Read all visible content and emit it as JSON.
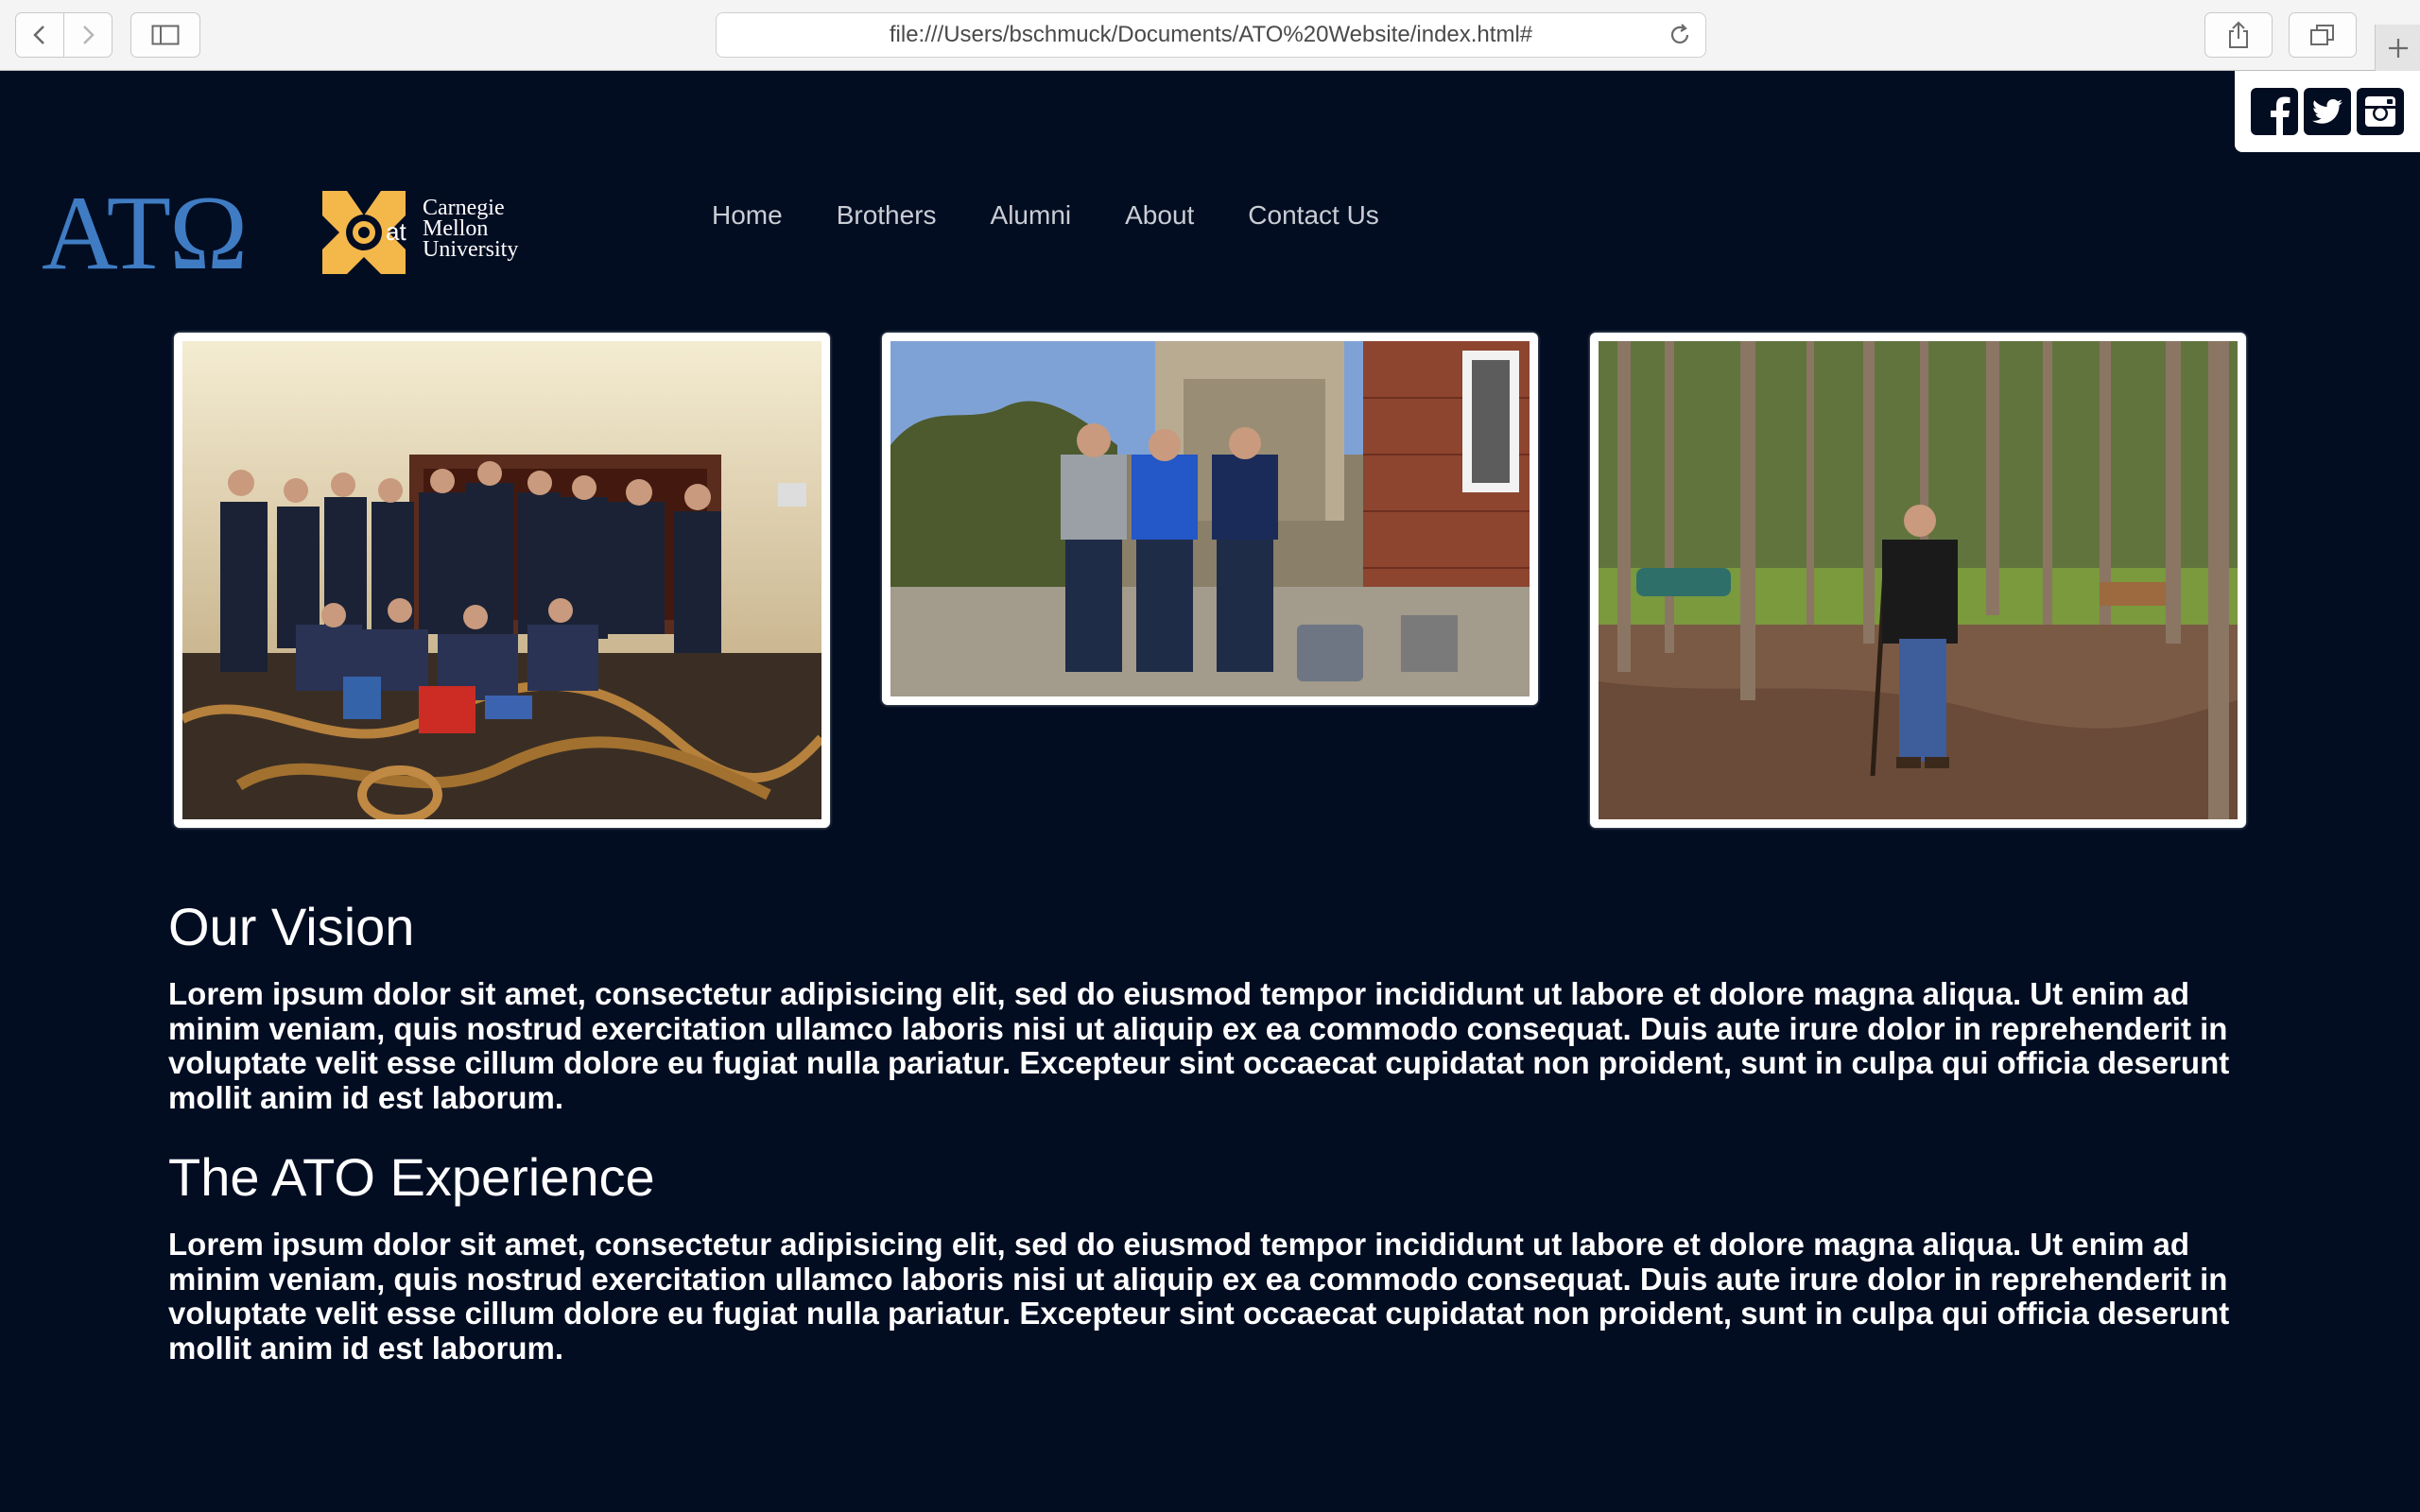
{
  "browser": {
    "url": "file:///Users/bschmuck/Documents/ATO%20Website/index.html#",
    "back_icon": "chevron-left-icon",
    "forward_icon": "chevron-right-icon",
    "sidebar_icon": "sidebar-icon",
    "reload_icon": "reload-icon",
    "share_icon": "share-icon",
    "tabs_icon": "tabs-icon",
    "new_tab_icon": "plus-icon"
  },
  "social": {
    "icons": [
      "facebook-icon",
      "twitter-icon",
      "instagram-icon"
    ]
  },
  "logo": {
    "letters": "ΑΤΩ",
    "at": "at",
    "university_line1": "Carnegie",
    "university_line2": "Mellon",
    "university_line3": "University",
    "colors": {
      "blue": "#3f7cc3",
      "gold": "#f4b74a"
    }
  },
  "nav": {
    "items": [
      {
        "label": "Home"
      },
      {
        "label": "Brothers"
      },
      {
        "label": "Alumni"
      },
      {
        "label": "About"
      },
      {
        "label": "Contact Us"
      }
    ]
  },
  "photos": [
    {
      "subject": "group photo of brothers in hotel lobby"
    },
    {
      "subject": "three brothers standing beside brick house"
    },
    {
      "subject": "brother hiking in a forest"
    }
  ],
  "sections": [
    {
      "heading": "Our Vision",
      "body": "Lorem ipsum dolor sit amet, consectetur adipisicing elit, sed do eiusmod tempor incididunt ut labore et dolore magna aliqua. Ut enim ad minim veniam, quis nostrud exercitation ullamco laboris nisi ut aliquip ex ea commodo consequat. Duis aute irure dolor in reprehenderit in voluptate velit esse cillum dolore eu fugiat nulla pariatur. Excepteur sint occaecat cupidatat non proident, sunt in culpa qui officia deserunt mollit anim id est laborum."
    },
    {
      "heading": "The ATO Experience",
      "body": "Lorem ipsum dolor sit amet, consectetur adipisicing elit, sed do eiusmod tempor incididunt ut labore et dolore magna aliqua. Ut enim ad minim veniam, quis nostrud exercitation ullamco laboris nisi ut aliquip ex ea commodo consequat. Duis aute irure dolor in reprehenderit in voluptate velit esse cillum dolore eu fugiat nulla pariatur. Excepteur sint occaecat cupidatat non proident, sunt in culpa qui officia deserunt mollit anim id est laborum."
    }
  ],
  "colors": {
    "page_background": "#020d22",
    "nav_text": "#c9cdd4",
    "text": "#ffffff"
  }
}
